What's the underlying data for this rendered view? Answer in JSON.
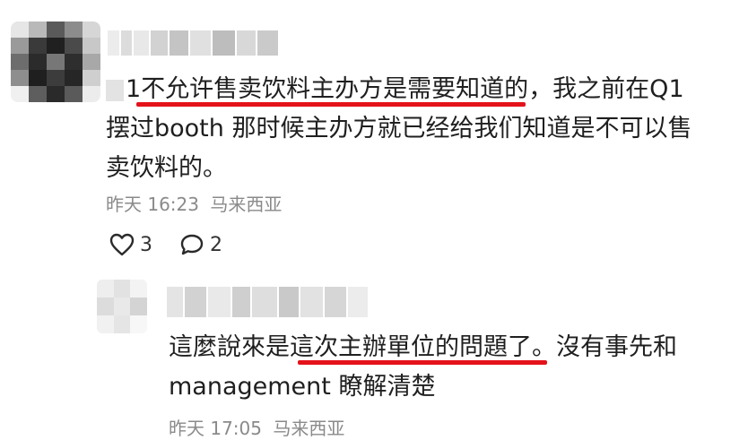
{
  "comment": {
    "text_prefix_blur": "",
    "text_line1_a": "1",
    "text_line1_highlight": "不允许售卖饮料主办方是需要知道的",
    "text_line1_b": "，我之前在Q1",
    "text_line2": "摆过booth 那时候主办方就已经给我们知道是不可以售",
    "text_line3": "卖饮料的。",
    "timestamp": "昨天 16:23",
    "location": "马来西亚",
    "likes": "3",
    "replies": "2"
  },
  "reply": {
    "text_line1_a": "這麼說來是",
    "text_line1_highlight": "這次主辦單位的問題了",
    "text_line1_b": "。沒有事先和",
    "text_line2": "management 瞭解清楚",
    "timestamp": "昨天 17:05",
    "location": "马来西亚"
  },
  "colors": {
    "highlight_underline": "#e4131a",
    "meta_text": "#8a8a8a"
  },
  "icons": {
    "like": "heart-outline-icon",
    "reply": "speech-bubble-icon"
  }
}
